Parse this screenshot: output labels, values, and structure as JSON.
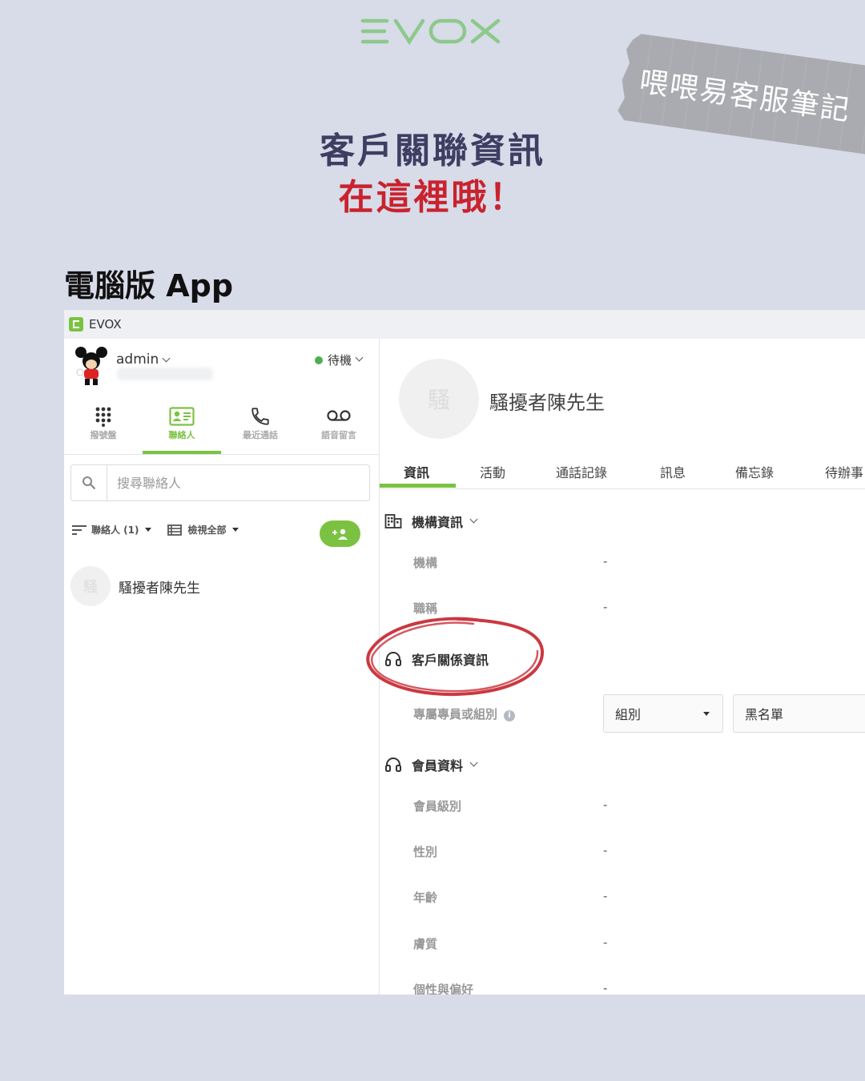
{
  "brand": {
    "logo_text": "EVOX"
  },
  "tape": {
    "text": "喂喂易客服筆記"
  },
  "headline": {
    "line1": "客戶關聯資訊",
    "line2": "在這裡哦！"
  },
  "section_label": "電腦版 App",
  "colors": {
    "background": "#d8dbe8",
    "accent_green": "#7cc242",
    "headline_navy": "#3d3e62",
    "headline_red": "#c8232e",
    "circle_red": "#c5222c",
    "tape_gray": "#a9abb0"
  },
  "app": {
    "title": "EVOX",
    "user": {
      "name": "admin",
      "status": "待機"
    },
    "nav": [
      {
        "label": "撥號盤",
        "icon": "dialpad-icon"
      },
      {
        "label": "聯絡人",
        "icon": "contact-card-icon"
      },
      {
        "label": "最近通話",
        "icon": "phone-icon"
      },
      {
        "label": "語音留言",
        "icon": "voicemail-icon"
      }
    ],
    "search": {
      "placeholder": "搜尋聯絡人"
    },
    "filters": {
      "sort": "聯絡人 (1)",
      "view": "檢視全部"
    },
    "contacts": [
      {
        "initial": "騷",
        "name": "騷擾者陳先生"
      }
    ],
    "detail": {
      "initial": "騷",
      "name": "騷擾者陳先生",
      "tabs": [
        "資訊",
        "活動",
        "通話記錄",
        "訊息",
        "備忘錄",
        "待辦事"
      ],
      "org_section": {
        "title": "機構資訊",
        "fields": [
          {
            "label": "機構",
            "value": "-"
          },
          {
            "label": "職稱",
            "value": "-"
          }
        ]
      },
      "crm_section": {
        "title": "客戶關係資訊",
        "owner_label": "專屬專員或組別",
        "select1": "組別",
        "select2": "黑名單"
      },
      "member_section": {
        "title": "會員資料",
        "fields": [
          {
            "label": "會員級別",
            "value": "-"
          },
          {
            "label": "性別",
            "value": "-"
          },
          {
            "label": "年齡",
            "value": "-"
          },
          {
            "label": "膚質",
            "value": "-"
          },
          {
            "label": "個性與偏好",
            "value": "-"
          }
        ]
      }
    }
  }
}
